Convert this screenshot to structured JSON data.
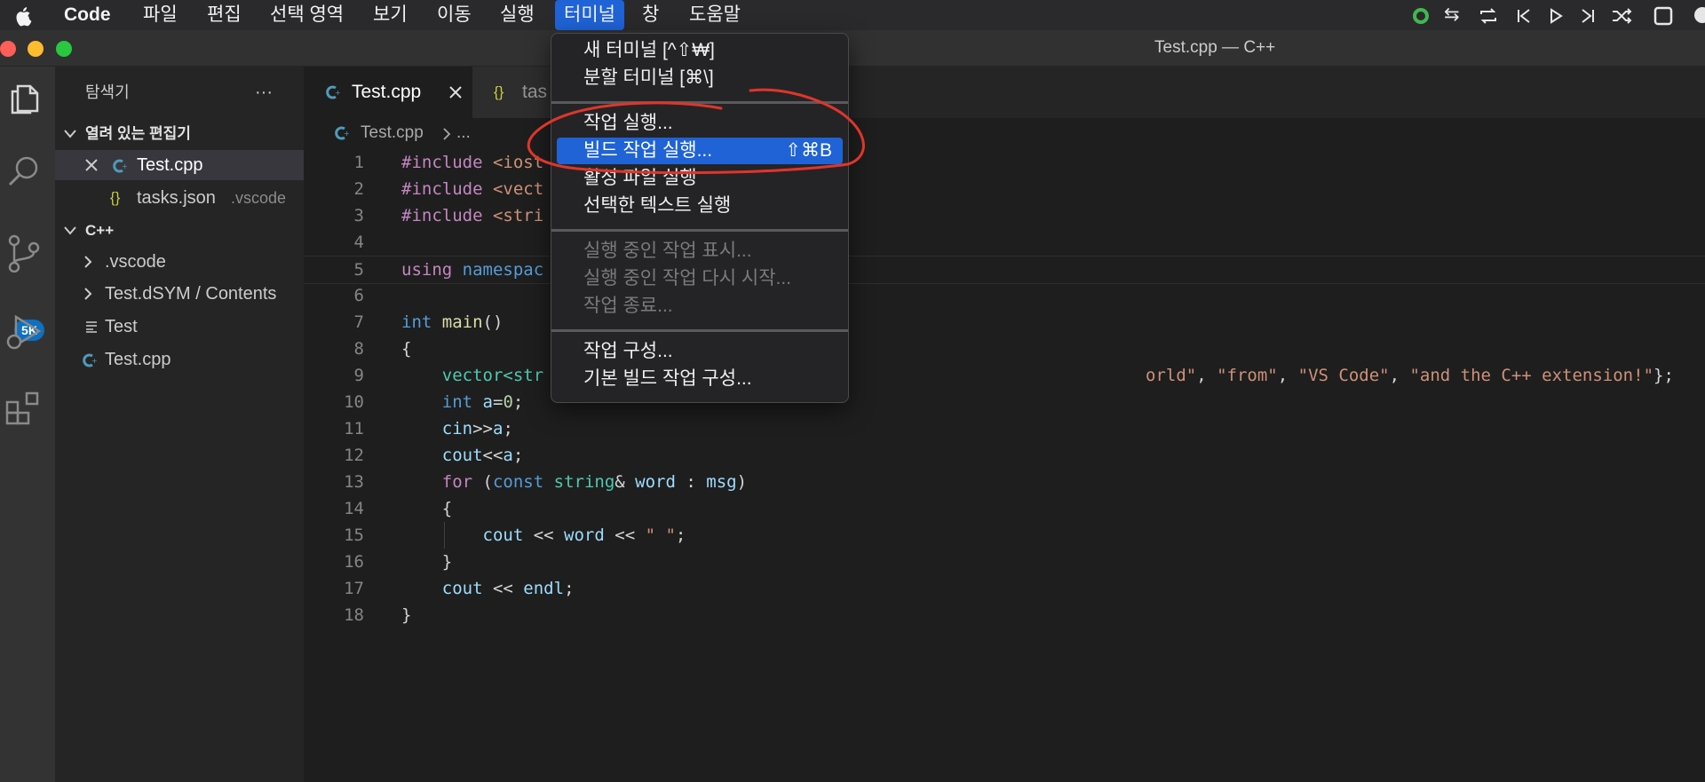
{
  "menubar": {
    "app_name": "Code",
    "items": [
      "파일",
      "편집",
      "선택 영역",
      "보기",
      "이동",
      "실행",
      "터미널",
      "창",
      "도움말"
    ],
    "active_item": "터미널"
  },
  "window": {
    "title": "Test.cpp — C++"
  },
  "activity_bar": {
    "badge": "5K"
  },
  "sidebar": {
    "title": "탐색기",
    "more": "···",
    "open_editors_header": "열려 있는 편집기",
    "open_editors": [
      {
        "name": "Test.cpp",
        "detail": ""
      },
      {
        "name": "tasks.json",
        "detail": ".vscode"
      }
    ],
    "folder_header": "C++",
    "tree": [
      ".vscode",
      "Test.dSYM / Contents",
      "Test",
      "Test.cpp"
    ]
  },
  "tabs": [
    {
      "label": "Test.cpp",
      "active": true
    },
    {
      "label": "tas",
      "active": false
    }
  ],
  "breadcrumb": {
    "file": "Test.cpp",
    "rest": "..."
  },
  "code_lines": [
    {
      "n": "1"
    },
    {
      "n": "2"
    },
    {
      "n": "3"
    },
    {
      "n": "4"
    },
    {
      "n": "5"
    },
    {
      "n": "6"
    },
    {
      "n": "7"
    },
    {
      "n": "8"
    },
    {
      "n": "9"
    },
    {
      "n": "10"
    },
    {
      "n": "11"
    },
    {
      "n": "12"
    },
    {
      "n": "13"
    },
    {
      "n": "14"
    },
    {
      "n": "15"
    },
    {
      "n": "16"
    },
    {
      "n": "17"
    },
    {
      "n": "18"
    }
  ],
  "code": {
    "l1a": "#include ",
    "l1b": "<iost",
    "l2a": "#include ",
    "l2b": "<vect",
    "l3a": "#include ",
    "l3b": "<stri",
    "l5a": "using ",
    "l5b": "namespac",
    "l7a": "int ",
    "l7b": "main",
    "l7c": "()",
    "l8": "{",
    "l9a": "    vector",
    "l9b": "<str",
    "l9c": "orld\"",
    "l9d": ", ",
    "l9e": "\"from\"",
    "l9f": ", ",
    "l9g": "\"VS Code\"",
    "l9h": ", ",
    "l9i": "\"and the C++ extension!\"",
    "l9j": "};",
    "l10a": "    ",
    "l10b": "int ",
    "l10c": "a",
    "l10d": "=",
    "l10e": "0",
    "l10f": ";",
    "l11a": "    ",
    "l11b": "cin",
    "l11c": ">>",
    "l11d": "a",
    "l11e": ";",
    "l12a": "    ",
    "l12b": "cout",
    "l12c": "<<",
    "l12d": "a",
    "l12e": ";",
    "l13a": "    ",
    "l13b": "for ",
    "l13c": "(",
    "l13d": "const ",
    "l13e": "string",
    "l13f": "& ",
    "l13g": "word",
    "l13h": " : ",
    "l13i": "msg",
    "l13j": ")",
    "l14": "    {",
    "l15a": "        ",
    "l15b": "cout",
    "l15c": " << ",
    "l15d": "word",
    "l15e": " << ",
    "l15f": "\" \"",
    "l15g": ";",
    "l16": "    }",
    "l17a": "    ",
    "l17b": "cout",
    "l17c": " << ",
    "l17d": "endl",
    "l17e": ";",
    "l18": "}"
  },
  "terminal_menu": {
    "group1": [
      {
        "label": "새 터미널 [^⇧₩]"
      },
      {
        "label": "분할 터미널 [⌘\\]"
      }
    ],
    "group2": [
      {
        "label": "작업 실행..."
      },
      {
        "label": "빌드 작업 실행...",
        "shortcut": "⇧⌘B"
      },
      {
        "label": "활성 파일 실행"
      },
      {
        "label": "선택한 텍스트 실행"
      }
    ],
    "group3": [
      {
        "label": "실행 중인 작업 표시..."
      },
      {
        "label": "실행 중인 작업 다시 시작..."
      },
      {
        "label": "작업 종료..."
      }
    ],
    "group4": [
      {
        "label": "작업 구성..."
      },
      {
        "label": "기본 빌드 작업 구성..."
      }
    ]
  },
  "colors": {
    "menu_highlight": "#1f63d6",
    "annotation_stroke": "#e0352b",
    "badge": "#0e70c0"
  }
}
